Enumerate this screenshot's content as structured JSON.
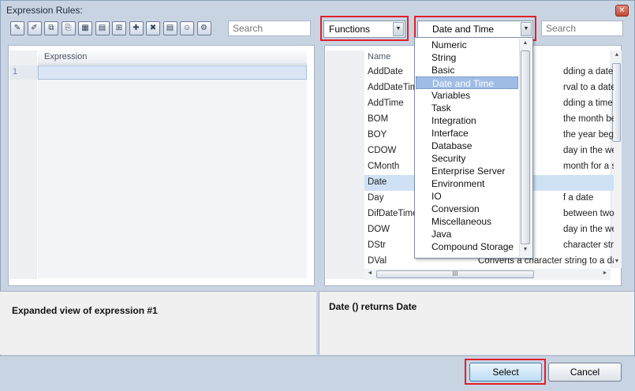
{
  "window": {
    "title": "Expression Rules:",
    "close_icon": "close-icon"
  },
  "toolbar": {
    "icons": [
      "new-expression-icon",
      "edit-expression-icon",
      "copy-icon",
      "paste-icon",
      "grid-icon",
      "table-icon",
      "insert-row-icon",
      "add-item-icon",
      "delete-icon",
      "document-icon",
      "users-icon",
      "properties-icon"
    ],
    "search_placeholder": "Search"
  },
  "expression_grid": {
    "column_header": "Expression",
    "row_number": "1"
  },
  "category_combo": {
    "value": "Functions"
  },
  "subcategory_combo": {
    "value": "Date and Time"
  },
  "right_search_placeholder": "Search",
  "functions_list": {
    "column_header": "Name",
    "rows": [
      {
        "name": "AddDate",
        "desc": "dding a date to a Da"
      },
      {
        "name": "AddDateTim",
        "desc": "rval to a date and ti"
      },
      {
        "name": "AddTime",
        "desc": "dding a time to an H"
      },
      {
        "name": "BOM",
        "desc": "the month begins fo"
      },
      {
        "name": "BOY",
        "desc": "the year begins for"
      },
      {
        "name": "CDOW",
        "desc": "day in the week for a"
      },
      {
        "name": "CMonth",
        "desc": "month for a specifiec"
      },
      {
        "name": "Date",
        "desc": ""
      },
      {
        "name": "Day",
        "desc": "f a date"
      },
      {
        "name": "DifDateTime",
        "desc": "between two Datetin"
      },
      {
        "name": "DOW",
        "desc": "day in the week for"
      },
      {
        "name": "DStr",
        "desc": "character string acc"
      },
      {
        "name": "DVal",
        "desc": "Converts a character string to a date value acc"
      }
    ],
    "selected_index": 7
  },
  "dropdown": {
    "items": [
      "Numeric",
      "String",
      "Basic",
      "Date and Time",
      "Variables",
      "Task",
      "Integration",
      "Interface",
      "Database",
      "Security",
      "Enterprise Server",
      "Environment",
      "IO",
      "Conversion",
      "Miscellaneous",
      "Java",
      "Compound Storage"
    ],
    "selected": "Date and Time"
  },
  "bottom": {
    "expanded_label": "Expanded view of expression #1",
    "function_signature": "Date () returns Date"
  },
  "buttons": {
    "select": "Select",
    "cancel": "Cancel"
  },
  "colors": {
    "highlight_red": "#e0202a",
    "selection_blue": "#cfe1f4"
  }
}
